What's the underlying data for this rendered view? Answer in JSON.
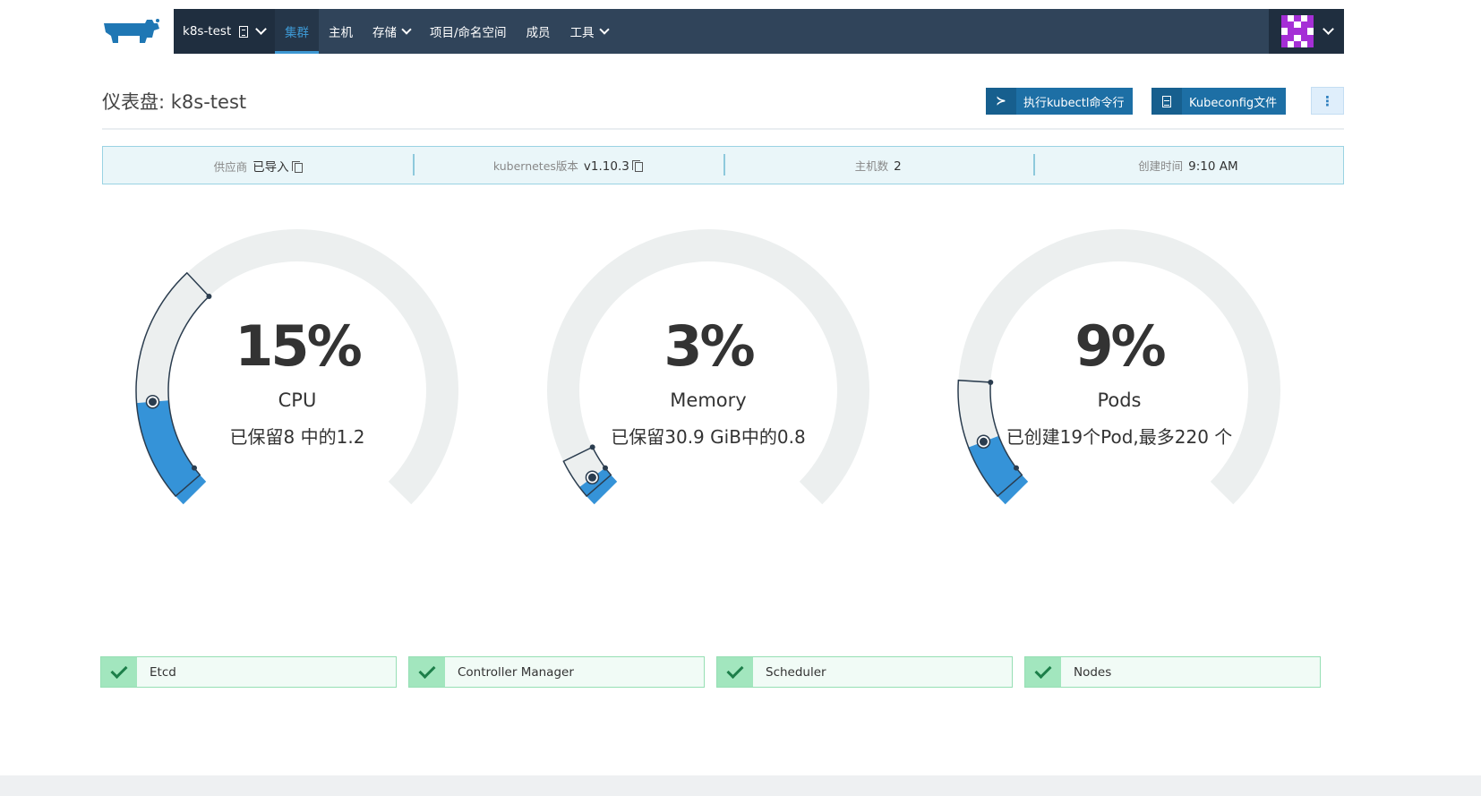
{
  "header": {
    "cluster_name": "k8s-test",
    "nav": [
      {
        "label": "集群",
        "active": true,
        "dropdown": false
      },
      {
        "label": "主机",
        "active": false,
        "dropdown": false
      },
      {
        "label": "存储",
        "active": false,
        "dropdown": true
      },
      {
        "label": "项目/命名空间",
        "active": false,
        "dropdown": false
      },
      {
        "label": "成员",
        "active": false,
        "dropdown": false
      },
      {
        "label": "工具",
        "active": false,
        "dropdown": true
      }
    ]
  },
  "page": {
    "title": "仪表盘: k8s-test",
    "kubectl_button": "执行kubectl命令行",
    "kubeconfig_button": "Kubeconfig文件",
    "more_button": "⋮"
  },
  "info": {
    "provider_label": "供应商",
    "provider_value": "已导入",
    "k8s_label": "kubernetes版本",
    "k8s_value": "v1.10.3",
    "hosts_label": "主机数",
    "hosts_value": "2",
    "created_label": "创建时间",
    "created_value": "9:10 AM"
  },
  "gauges": [
    {
      "percent_label": "15%",
      "percent": 15,
      "reserved_percent": 34,
      "name": "CPU",
      "detail": "已保留8 中的1.2"
    },
    {
      "percent_label": "3%",
      "percent": 3,
      "reserved_percent": 7,
      "name": "Memory",
      "detail": "已保留30.9 GiB中的0.8"
    },
    {
      "percent_label": "9%",
      "percent": 9,
      "reserved_percent": 18,
      "name": "Pods",
      "detail": "已创建19个Pod,最多220 个"
    }
  ],
  "components": [
    {
      "label": "Etcd",
      "status": "healthy"
    },
    {
      "label": "Controller Manager",
      "status": "healthy"
    },
    {
      "label": "Scheduler",
      "status": "healthy"
    },
    {
      "label": "Nodes",
      "status": "healthy"
    }
  ],
  "colors": {
    "navbar": "#30445a",
    "accent": "#3d98d3",
    "button": "#1d6fa5",
    "gauge_track": "#ecefef",
    "gauge_fill": "#3593d8",
    "status_ok": "#a2e6be"
  },
  "icons": {
    "logo": "rancher-cow-logo",
    "kubectl": "terminal-icon",
    "kubeconfig": "file-icon",
    "copy": "copy-icon",
    "status": "check-icon"
  }
}
